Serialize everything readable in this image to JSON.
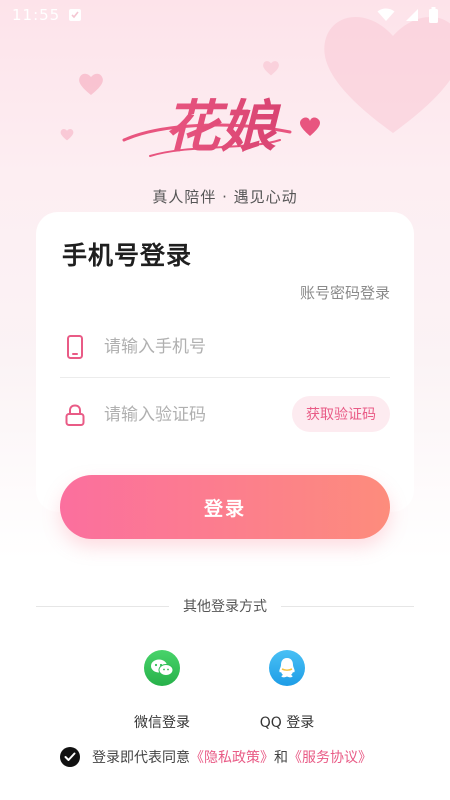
{
  "status_bar": {
    "time": "11:55"
  },
  "brand": {
    "logo_text": "花娘",
    "tagline": "真人陪伴 · 遇见心动"
  },
  "login": {
    "title": "手机号登录",
    "switch_label": "账号密码登录",
    "phone_placeholder": "请输入手机号",
    "code_placeholder": "请输入验证码",
    "get_code_label": "获取验证码",
    "submit_label": "登录"
  },
  "other": {
    "divider_label": "其他登录方式",
    "wechat_label": "微信登录",
    "qq_label": "QQ 登录"
  },
  "agreement": {
    "prefix": "登录即代表同意",
    "privacy": "《隐私政策》",
    "and": "和",
    "terms": "《服务协议》"
  },
  "colors": {
    "accent": "#e95b86",
    "button_start": "#fb6f9e",
    "button_end": "#fd8c7c",
    "wechat": "#2fbf55",
    "qq": "#2aa8ee"
  }
}
